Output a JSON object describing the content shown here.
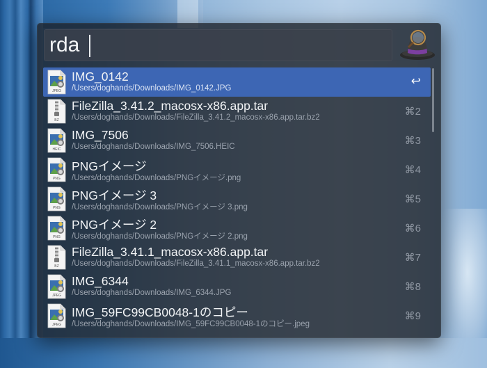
{
  "search": {
    "query": "rda"
  },
  "results": [
    {
      "title": "IMG_0142",
      "path": "/Users/doghands/Downloads/IMG_0142.JPG",
      "shortcut": "↩",
      "file_type": "JPEG",
      "icon": "jpeg-file-icon"
    },
    {
      "title": "FileZilla_3.41.2_macosx-x86.app.tar",
      "path": "/Users/doghands/Downloads/FileZilla_3.41.2_macosx-x86.app.tar.bz2",
      "shortcut": "⌘2",
      "file_type": "BZ",
      "icon": "zip-file-icon"
    },
    {
      "title": "IMG_7506",
      "path": "/Users/doghands/Downloads/IMG_7506.HEIC",
      "shortcut": "⌘3",
      "file_type": "HEIC",
      "icon": "heic-file-icon"
    },
    {
      "title": "PNGイメージ",
      "path": "/Users/doghands/Downloads/PNGイメージ.png",
      "shortcut": "⌘4",
      "file_type": "PNG",
      "icon": "png-file-icon"
    },
    {
      "title": "PNGイメージ 3",
      "path": "/Users/doghands/Downloads/PNGイメージ 3.png",
      "shortcut": "⌘5",
      "file_type": "PNG",
      "icon": "png-file-icon"
    },
    {
      "title": "PNGイメージ 2",
      "path": "/Users/doghands/Downloads/PNGイメージ 2.png",
      "shortcut": "⌘6",
      "file_type": "PNG",
      "icon": "png-file-icon"
    },
    {
      "title": "FileZilla_3.41.1_macosx-x86.app.tar",
      "path": "/Users/doghands/Downloads/FileZilla_3.41.1_macosx-x86.app.tar.bz2",
      "shortcut": "⌘7",
      "file_type": "BZ",
      "icon": "zip-file-icon"
    },
    {
      "title": "IMG_6344",
      "path": "/Users/doghands/Downloads/IMG_6344.JPG",
      "shortcut": "⌘8",
      "file_type": "JPEG",
      "icon": "jpeg-file-icon"
    },
    {
      "title": "IMG_59FC99CB0048-1のコピー",
      "path": "/Users/doghands/Downloads/IMG_59FC99CB0048-1のコピー.jpeg",
      "shortcut": "⌘9",
      "file_type": "JPEG",
      "icon": "jpeg-file-icon"
    }
  ],
  "colors": {
    "selection": "#3d66b4",
    "window": "#1c2028"
  }
}
